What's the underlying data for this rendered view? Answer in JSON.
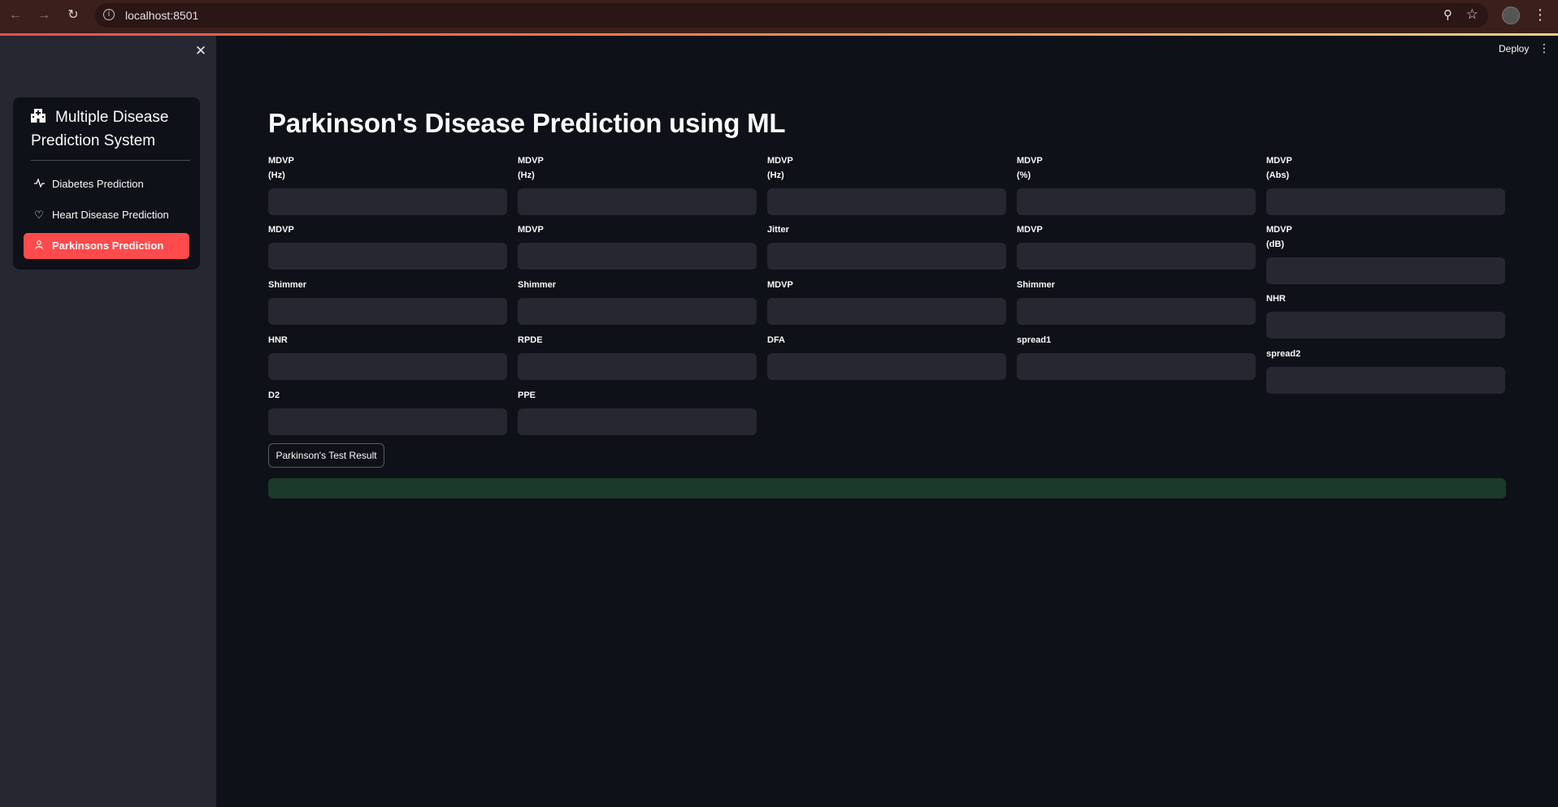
{
  "browser": {
    "url": "localhost:8501",
    "back_icon": "arrow-left-icon",
    "forward_icon": "arrow-right-icon",
    "reload_icon": "reload-icon"
  },
  "header": {
    "deploy_label": "Deploy"
  },
  "sidebar": {
    "menu_title": "Multiple Disease Prediction System",
    "items": [
      {
        "label": "Diabetes Prediction",
        "icon": "activity-icon",
        "active": false
      },
      {
        "label": "Heart Disease Prediction",
        "icon": "heart-icon",
        "active": false
      },
      {
        "label": "Parkinsons Prediction",
        "icon": "person-icon",
        "active": true
      }
    ]
  },
  "main": {
    "title": "Parkinson's Disease Prediction using ML",
    "fields": [
      {
        "label": "MDVP\n(Hz)",
        "value": ""
      },
      {
        "label": "MDVP\n(Hz)",
        "value": ""
      },
      {
        "label": "MDVP\n(Hz)",
        "value": ""
      },
      {
        "label": "MDVP\n(%)",
        "value": ""
      },
      {
        "label": "MDVP\n(Abs)",
        "value": ""
      },
      {
        "label": "MDVP",
        "value": ""
      },
      {
        "label": "MDVP",
        "value": ""
      },
      {
        "label": "Jitter",
        "value": ""
      },
      {
        "label": "MDVP",
        "value": ""
      },
      {
        "label": "MDVP\n(dB)",
        "value": ""
      },
      {
        "label": "Shimmer",
        "value": ""
      },
      {
        "label": "Shimmer",
        "value": ""
      },
      {
        "label": "MDVP",
        "value": ""
      },
      {
        "label": "Shimmer",
        "value": ""
      },
      {
        "label": "NHR",
        "value": ""
      },
      {
        "label": "HNR",
        "value": ""
      },
      {
        "label": "RPDE",
        "value": ""
      },
      {
        "label": "DFA",
        "value": ""
      },
      {
        "label": "spread1",
        "value": ""
      },
      {
        "label": "spread2",
        "value": ""
      },
      {
        "label": "D2",
        "value": ""
      },
      {
        "label": "PPE",
        "value": ""
      }
    ],
    "result_button_label": "Parkinson's Test Result",
    "result_text": ""
  }
}
